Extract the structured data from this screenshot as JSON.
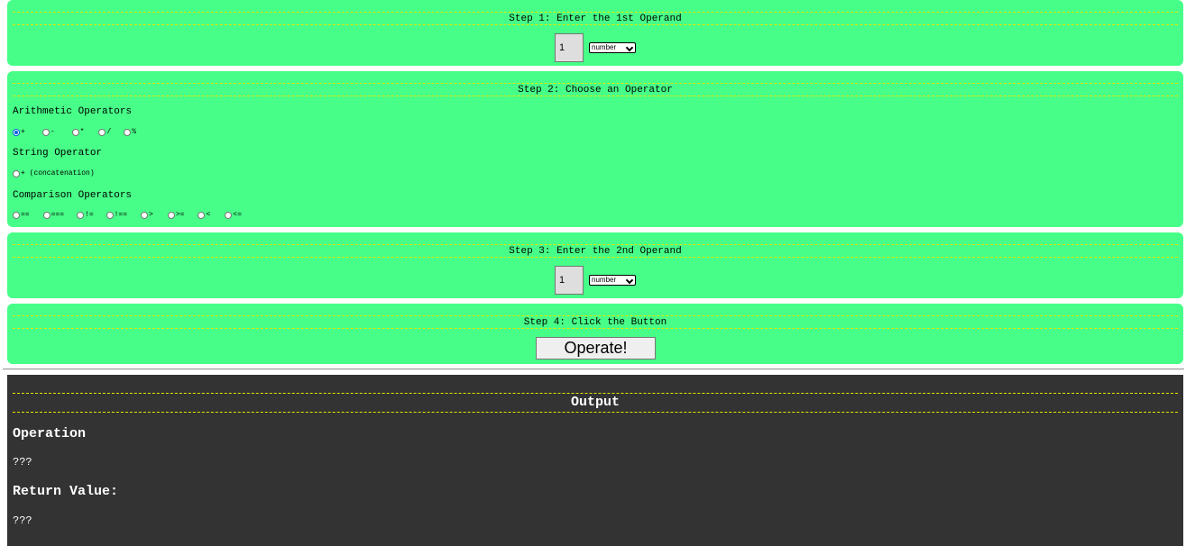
{
  "step1": {
    "title": "Step 1: Enter the 1st Operand",
    "operand_value": "1",
    "type_selected": "number"
  },
  "step2": {
    "title": "Step 2: Choose an Operator",
    "arithmetic": {
      "label": "Arithmetic Operators",
      "options": [
        "+",
        "-",
        "*",
        "/",
        "%"
      ],
      "selected": "+"
    },
    "string": {
      "label": "String Operator",
      "options": [
        "+ (concatenation)"
      ]
    },
    "comparison": {
      "label": "Comparison Operators",
      "options": [
        "==",
        "===",
        "!=",
        "!==",
        ">",
        ">=",
        "<",
        "<="
      ]
    }
  },
  "step3": {
    "title": "Step 3: Enter the 2nd Operand",
    "operand_value": "1",
    "type_selected": "number"
  },
  "step4": {
    "title": "Step 4: Click the Button",
    "button_label": "Operate!"
  },
  "output": {
    "title": "Output",
    "operation_label": "Operation",
    "operation_value": "???",
    "return_label": "Return Value:",
    "return_value": "???"
  },
  "colors": {
    "panel_bg": "#47ff88",
    "output_bg": "#333333",
    "dashed_line": "#e6e600",
    "radio_selected": "#0060df"
  }
}
